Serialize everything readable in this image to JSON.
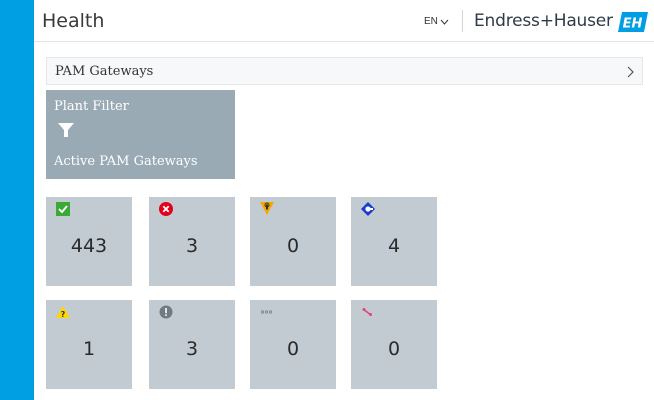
{
  "header": {
    "title": "Health",
    "language": "EN",
    "brand": "Endress+Hauser",
    "brand_logo": "EH"
  },
  "breadcrumb": {
    "label": "PAM Gateways"
  },
  "filter_tile": {
    "title": "Plant Filter",
    "icon": "filter-icon",
    "subtitle": "Active PAM Gateways"
  },
  "status_tiles": [
    {
      "icon": "ok-check-icon",
      "count": "443",
      "color": "#3aa935"
    },
    {
      "icon": "failure-x-icon",
      "count": "3",
      "color": "#e2001a"
    },
    {
      "icon": "maintenance-wrench-icon",
      "count": "0",
      "color": "#f5a800"
    },
    {
      "icon": "function-check-diamond-icon",
      "count": "4",
      "color": "#1a3ccc"
    },
    {
      "icon": "out-of-spec-warning-icon",
      "count": "1",
      "color": "#ffd600"
    },
    {
      "icon": "unknown-exclamation-icon",
      "count": "3",
      "color": "#6f7a82"
    },
    {
      "icon": "not-categorized-dots-icon",
      "count": "0",
      "color": "#7a8288"
    },
    {
      "icon": "disconnected-icon",
      "count": "0",
      "color": "#e0457b"
    }
  ],
  "colors": {
    "accent": "#009ee3",
    "filter_tile_bg": "#99aab4",
    "status_tile_bg": "#c2cbd1"
  }
}
